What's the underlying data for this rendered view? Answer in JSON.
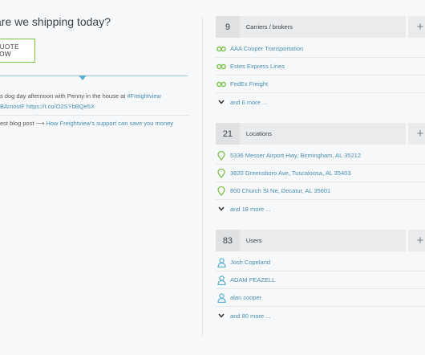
{
  "left": {
    "question": "are we shipping today?",
    "quote_button": "QUOTE NOW",
    "tweet_text": "s dog day afternoon with Penny in the house at ",
    "tweet_hashtag": "#Freightview",
    "tweet_links": "BAmostF https://t.co/O2SYbBQe5X",
    "blog_prefix": "est blog post ⟶",
    "blog_link": "How Freightview's support can save you money"
  },
  "panels": {
    "carriers": {
      "count": "9",
      "title": "Carriers / brokers",
      "items": [
        "AAA Cooper Transportation",
        "Estes Express Lines",
        "FedEx Freight"
      ],
      "more": "and 6 more ...",
      "item_icon": "link-chain-icon"
    },
    "locations": {
      "count": "21",
      "title": "Locations",
      "items": [
        "5336 Messer Airport Hwy, Birmingham, AL 35212",
        "3820 Greensboro Ave, Tuscaloosa, AL 35403",
        "800 Church St Ne, Decatur, AL 35601"
      ],
      "more": "and 18 more ...",
      "item_icon": "map-pin-icon"
    },
    "users": {
      "count": "83",
      "title": "Users",
      "items": [
        "Josh Copeland",
        "ADAM FEAZELL",
        "alan cooper"
      ],
      "more": "and 80 more ...",
      "item_icon": "user-icon"
    }
  },
  "colors": {
    "accent_green": "#7dc24b",
    "link_blue": "#4a8fb0",
    "divider_blue": "#5ab0d4"
  }
}
